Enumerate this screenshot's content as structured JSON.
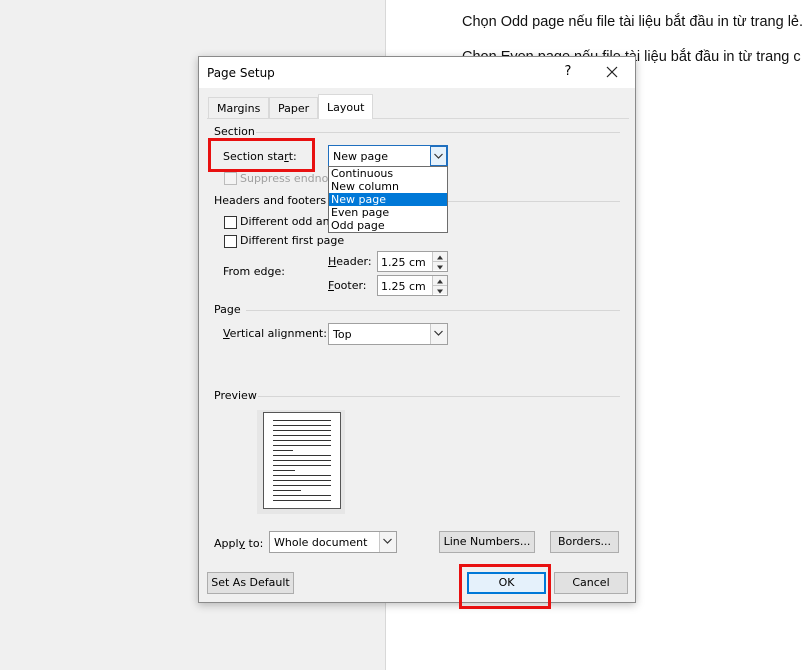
{
  "document": {
    "line1": "Chọn Odd page nếu file tài liệu bắt đầu in từ trang lẻ.",
    "line2": "Chọn Even page nếu file tài liệu bắt đầu in từ trang c"
  },
  "dialog": {
    "title": "Page Setup",
    "help_label": "?",
    "tabs": [
      "Margins",
      "Paper",
      "Layout"
    ],
    "active_tab": "Layout",
    "section": {
      "heading": "Section",
      "section_start_label": "Section start:",
      "section_start_value": "New page",
      "section_start_options": [
        "Continuous",
        "New column",
        "New page",
        "Even page",
        "Odd page"
      ],
      "selected_option_index": 2,
      "suppress_label": "Suppress endnotes"
    },
    "headers_footers": {
      "heading": "Headers and footers",
      "different_odd_even_label": "Different odd and even",
      "different_first_page_label": "Different first page",
      "from_edge_label": "From edge:",
      "header_label": "Header:",
      "header_value": "1.25 cm",
      "footer_label": "Footer:",
      "footer_value": "1.25 cm"
    },
    "page": {
      "heading": "Page",
      "vertical_alignment_label": "Vertical alignment:",
      "vertical_alignment_value": "Top"
    },
    "preview": {
      "heading": "Preview"
    },
    "apply_to_label": "Apply to:",
    "apply_to_value": "Whole document",
    "line_numbers_label": "Line Numbers...",
    "borders_label": "Borders...",
    "set_as_default_label": "Set As Default",
    "ok_label": "OK",
    "cancel_label": "Cancel"
  },
  "colors": {
    "highlight": "#e81010",
    "selection": "#0078d7",
    "dialog_bg": "#f0f0f0"
  }
}
